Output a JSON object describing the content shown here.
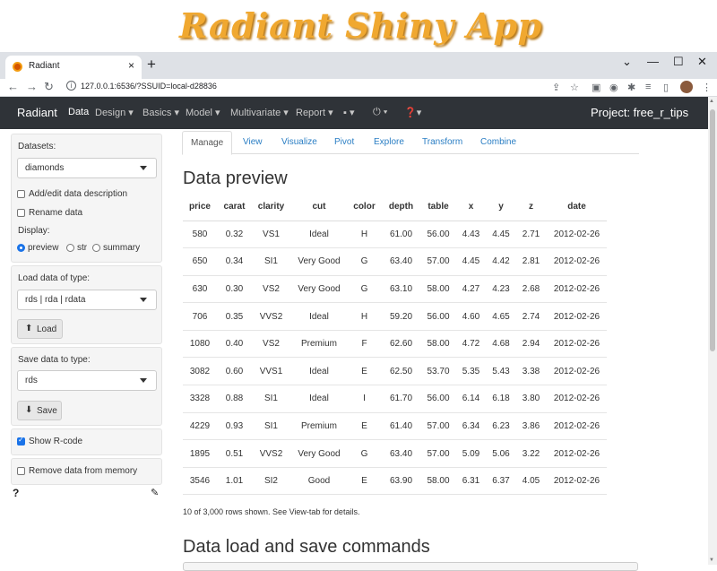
{
  "banner": {
    "title": "Radiant Shiny App"
  },
  "browser": {
    "tab_title": "Radiant",
    "tab_close": "×",
    "new_tab": "+",
    "window_controls": [
      "⌄",
      "—",
      "☐",
      "✕"
    ],
    "url": "127.0.0.1:6536/?SSUID=local-d28836"
  },
  "navbar": {
    "brand": "Radiant",
    "items": [
      "Data",
      "Design",
      "Basics",
      "Model",
      "Multivariate",
      "Report"
    ],
    "active_item": "Data",
    "project": "Project: free_r_tips"
  },
  "sidebar": {
    "datasets_label": "Datasets:",
    "dataset_value": "diamonds",
    "add_edit_label": "Add/edit data description",
    "add_edit_checked": false,
    "rename_label": "Rename data",
    "rename_checked": false,
    "display_label": "Display:",
    "display_options": [
      "preview",
      "str",
      "summary"
    ],
    "display_selected": "preview",
    "load_type_label": "Load data of type:",
    "load_type_value": "rds | rda | rdata",
    "load_button": "Load",
    "save_type_label": "Save data to type:",
    "save_type_value": "rds",
    "save_button": "Save",
    "show_rcode_label": "Show R-code",
    "show_rcode_checked": true,
    "remove_label": "Remove data from memory",
    "remove_checked": false,
    "help_icon": "?"
  },
  "main": {
    "tabs": [
      "Manage",
      "View",
      "Visualize",
      "Pivot",
      "Explore",
      "Transform",
      "Combine"
    ],
    "active_tab": "Manage",
    "preview_title": "Data preview",
    "table": {
      "columns": [
        "price",
        "carat",
        "clarity",
        "cut",
        "color",
        "depth",
        "table",
        "x",
        "y",
        "z",
        "date"
      ],
      "rows": [
        [
          "580",
          "0.32",
          "VS1",
          "Ideal",
          "H",
          "61.00",
          "56.00",
          "4.43",
          "4.45",
          "2.71",
          "2012-02-26"
        ],
        [
          "650",
          "0.34",
          "SI1",
          "Very Good",
          "G",
          "63.40",
          "57.00",
          "4.45",
          "4.42",
          "2.81",
          "2012-02-26"
        ],
        [
          "630",
          "0.30",
          "VS2",
          "Very Good",
          "G",
          "63.10",
          "58.00",
          "4.27",
          "4.23",
          "2.68",
          "2012-02-26"
        ],
        [
          "706",
          "0.35",
          "VVS2",
          "Ideal",
          "H",
          "59.20",
          "56.00",
          "4.60",
          "4.65",
          "2.74",
          "2012-02-26"
        ],
        [
          "1080",
          "0.40",
          "VS2",
          "Premium",
          "F",
          "62.60",
          "58.00",
          "4.72",
          "4.68",
          "2.94",
          "2012-02-26"
        ],
        [
          "3082",
          "0.60",
          "VVS1",
          "Ideal",
          "E",
          "62.50",
          "53.70",
          "5.35",
          "5.43",
          "3.38",
          "2012-02-26"
        ],
        [
          "3328",
          "0.88",
          "SI1",
          "Ideal",
          "I",
          "61.70",
          "56.00",
          "6.14",
          "6.18",
          "3.80",
          "2012-02-26"
        ],
        [
          "4229",
          "0.93",
          "SI1",
          "Premium",
          "E",
          "61.40",
          "57.00",
          "6.34",
          "6.23",
          "3.86",
          "2012-02-26"
        ],
        [
          "1895",
          "0.51",
          "VVS2",
          "Very Good",
          "G",
          "63.40",
          "57.00",
          "5.09",
          "5.06",
          "3.22",
          "2012-02-26"
        ],
        [
          "3546",
          "1.01",
          "SI2",
          "Good",
          "E",
          "63.90",
          "58.00",
          "6.31",
          "6.37",
          "4.05",
          "2012-02-26"
        ]
      ]
    },
    "rows_note": "10 of 3,000 rows shown. See View-tab for details.",
    "commands_title": "Data load and save commands"
  },
  "colors": {
    "navbar_bg": "#2f3338",
    "link": "#2a7ec4",
    "checkbox_accent": "#1a73e8",
    "banner_text": "#f0a830"
  }
}
